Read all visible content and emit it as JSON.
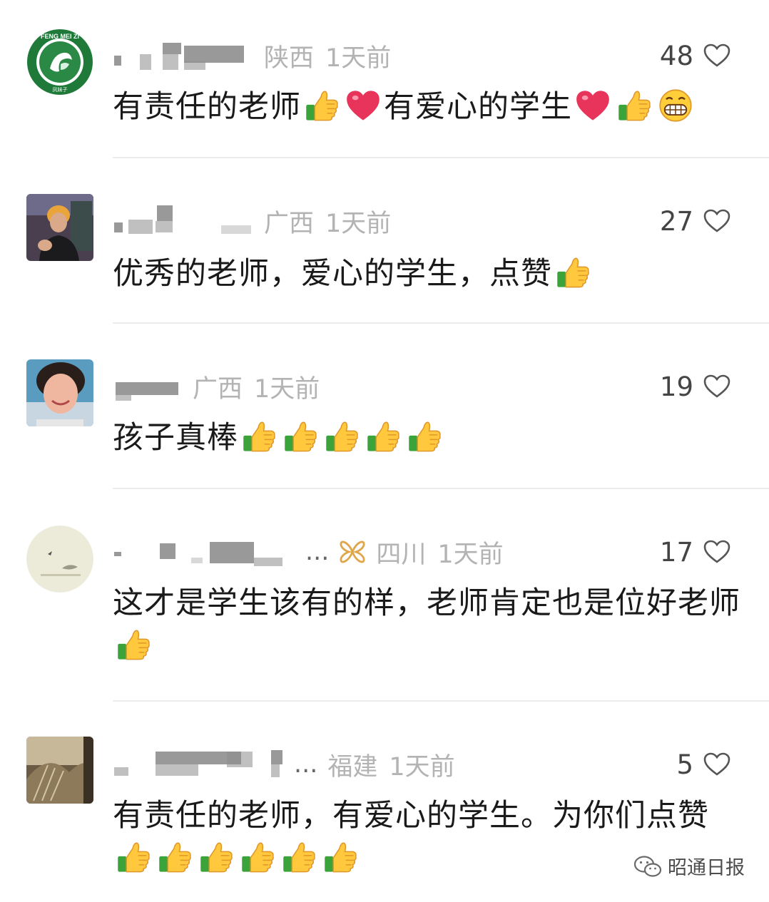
{
  "comments": [
    {
      "region": "陕西",
      "time": "1天前",
      "likes": "48",
      "content": [
        {
          "t": "有责任的老师"
        },
        {
          "e": "thumbs-up-icon"
        },
        {
          "e": "heart-icon"
        },
        {
          "t": "有爱心的学生"
        },
        {
          "e": "heart-icon"
        },
        {
          "e": "thumbs-up-icon"
        },
        {
          "e": "grin-icon"
        }
      ]
    },
    {
      "region": "广西",
      "time": "1天前",
      "likes": "27",
      "content": [
        {
          "t": "优秀的老师，爱心的学生，点赞"
        },
        {
          "e": "thumbs-up-icon"
        }
      ]
    },
    {
      "region": "广西",
      "time": "1天前",
      "likes": "19",
      "content": [
        {
          "t": "孩子真棒"
        },
        {
          "e": "thumbs-up-icon"
        },
        {
          "e": "thumbs-up-icon"
        },
        {
          "e": "thumbs-up-icon"
        },
        {
          "e": "thumbs-up-icon"
        },
        {
          "e": "thumbs-up-icon"
        }
      ]
    },
    {
      "region": "四川",
      "time": "1天前",
      "likes": "17",
      "name_suffix": "...",
      "content": [
        {
          "t": "这才是学生该有的样，老师肯定也是位好老师"
        },
        {
          "e": "thumbs-up-icon"
        }
      ]
    },
    {
      "region": "福建",
      "time": "1天前",
      "likes": "5",
      "name_suffix": "...",
      "content": [
        {
          "t": "有责任的老师，有爱心的学生。为你们点赞"
        },
        {
          "e": "thumbs-up-icon"
        },
        {
          "e": "thumbs-up-icon"
        },
        {
          "e": "thumbs-up-icon"
        },
        {
          "e": "thumbs-up-icon"
        },
        {
          "e": "thumbs-up-icon"
        },
        {
          "e": "thumbs-up-icon"
        }
      ]
    }
  ],
  "avatars": {
    "logo_text": "FENG MEI ZI",
    "logo_sub": "凤妹子"
  },
  "watermark": {
    "label": "昭通日报"
  },
  "colors": {
    "meta_gray": "#b3b3b3",
    "divider": "#ececec",
    "heart_red": "#e8345a",
    "thumb_yellow": "#ffc83d",
    "cuff_green": "#3aa33a"
  }
}
